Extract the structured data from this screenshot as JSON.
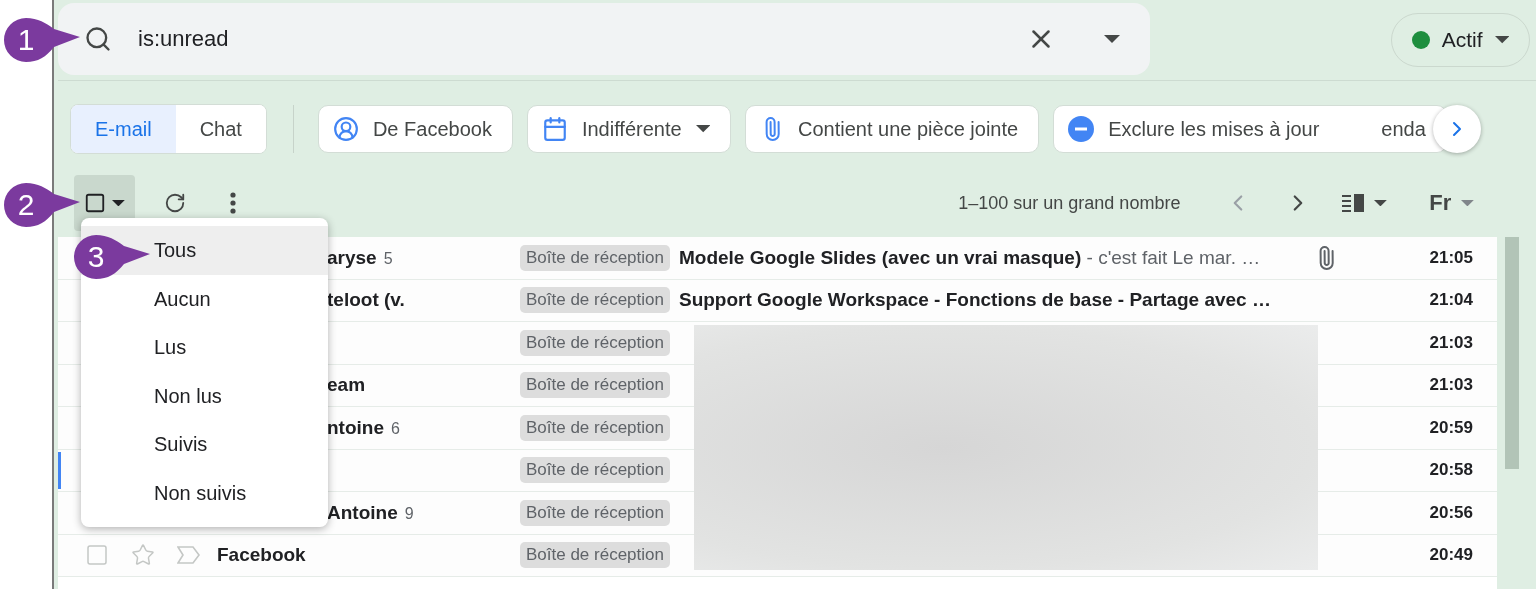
{
  "search": {
    "query": "is:unread"
  },
  "status": {
    "label": "Actif",
    "color": "#1e8e3e"
  },
  "tabs": [
    {
      "label": "E-mail",
      "selected": true
    },
    {
      "label": "Chat",
      "selected": false
    }
  ],
  "filter_chips": [
    {
      "kind": "sender",
      "label": "De Facebook"
    },
    {
      "kind": "date",
      "label": "Indifférente"
    },
    {
      "kind": "attachment",
      "label": "Contient une pièce jointe"
    },
    {
      "kind": "exclude",
      "label": "Exclure les mises à jour",
      "label_after_arrow": "enda"
    }
  ],
  "toolbar": {
    "range": "1–100 sur un grand nombre",
    "input_tool": "Fr"
  },
  "select_menu": {
    "items": [
      {
        "label": "Tous",
        "selected": true
      },
      {
        "label": "Aucun",
        "selected": false
      },
      {
        "label": "Lus",
        "selected": false
      },
      {
        "label": "Non lus",
        "selected": false
      },
      {
        "label": "Suivis",
        "selected": false
      },
      {
        "label": "Non suivis",
        "selected": false
      }
    ]
  },
  "rows": [
    {
      "sender": "aryse",
      "count": "5",
      "label": "Boîte de réception",
      "subject": "Modele Google Slides (avec un vrai masque)",
      "snippet": "- c'est fait Le mar. …",
      "attachment": true,
      "time": "21:05",
      "focused": false,
      "under_menu": true
    },
    {
      "sender": "teloot (v.",
      "label": "Boîte de réception",
      "subject": "Support Google Workspace - Fonctions de base - Partage avec …",
      "attachment": false,
      "time": "21:04",
      "focused": false,
      "under_menu": true
    },
    {
      "label": "Boîte de réception",
      "attachment": false,
      "time": "21:03",
      "focused": false
    },
    {
      "sender": "eam",
      "label": "Boîte de réception",
      "attachment": false,
      "time": "21:03",
      "focused": false,
      "under_menu": true
    },
    {
      "sender": "ntoine",
      "count": "6",
      "label": "Boîte de réception",
      "attachment": false,
      "time": "20:59",
      "focused": false,
      "under_menu": true
    },
    {
      "label": "Boîte de réception",
      "attachment": false,
      "time": "20:58",
      "focused": true
    },
    {
      "sender": "Antoine",
      "count": "9",
      "label": "Boîte de réception",
      "attachment": false,
      "time": "20:56",
      "focused": false,
      "under_menu": true
    },
    {
      "sender": "Facebook",
      "label": "Boîte de réception",
      "attachment": false,
      "time": "20:49",
      "focused": false,
      "under_menu": false,
      "checked": false
    }
  ],
  "callouts": [
    "1",
    "2",
    "3"
  ]
}
